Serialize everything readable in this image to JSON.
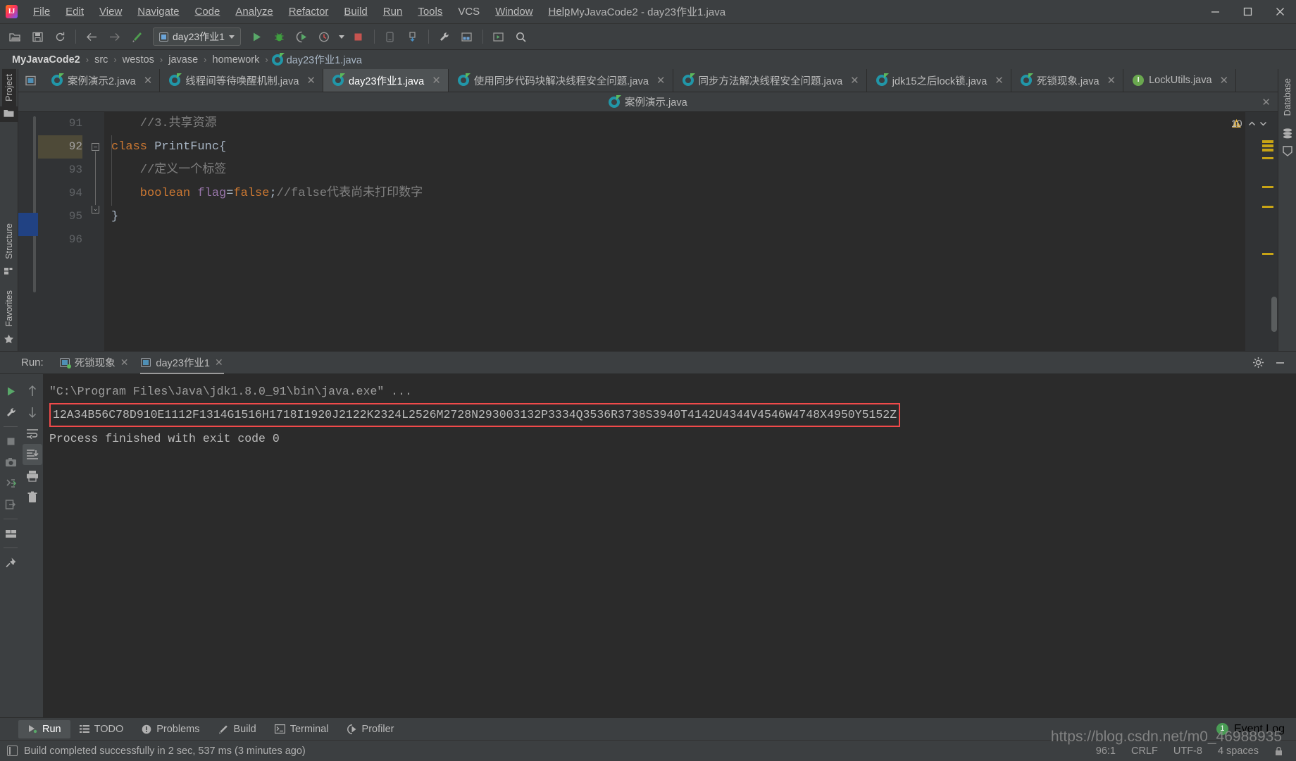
{
  "window": {
    "title": "MyJavaCode2 - day23作业1.java",
    "minimize": "–",
    "maximize": "❐",
    "close": "✕"
  },
  "menu": [
    {
      "label": "File"
    },
    {
      "label": "Edit"
    },
    {
      "label": "View"
    },
    {
      "label": "Navigate"
    },
    {
      "label": "Code"
    },
    {
      "label": "Analyze"
    },
    {
      "label": "Refactor"
    },
    {
      "label": "Build"
    },
    {
      "label": "Run"
    },
    {
      "label": "Tools"
    },
    {
      "label": "VCS"
    },
    {
      "label": "Window"
    },
    {
      "label": "Help"
    }
  ],
  "toolbar": {
    "icons": [
      "open-folder-icon",
      "save-all-icon",
      "sync-icon",
      "back-arrow-icon",
      "forward-arrow-icon",
      "build-hammer-icon"
    ],
    "run_config": "day23作业1",
    "run_icon": "run-green-triangle-icon",
    "debug_icon": "debug-bug-icon",
    "coverage_icon": "run-with-coverage-icon",
    "profiler_icon": "profile-clock-icon",
    "stop_icon": "stop-red-square-icon",
    "extra_icons": [
      "update-app-icon",
      "install-apk-icon",
      "settings-wrench-icon",
      "project-structure-icon",
      "avd-manager-icon",
      "search-everywhere-icon"
    ]
  },
  "breadcrumb": {
    "items": [
      "MyJavaCode2",
      "src",
      "westos",
      "javase",
      "homework"
    ],
    "file": "day23作业1.java",
    "separator": "›"
  },
  "left_rail": {
    "top": {
      "label": "Project",
      "icon": "project-folder-icon"
    },
    "bottom": [
      {
        "label": "Structure",
        "icon": "structure-icon"
      },
      {
        "label": "Favorites",
        "icon": "favorites-star-icon"
      }
    ]
  },
  "right_rail": [
    {
      "label": "Database",
      "icon": "database-icon"
    },
    {
      "label": "",
      "icon": "ant-build-icon"
    }
  ],
  "editor_tabs_row1": [
    {
      "label": "案例演示2.java",
      "icon": "java-class-icon",
      "active": false
    },
    {
      "label": "线程间等待唤醒机制.java",
      "icon": "java-class-icon",
      "active": false
    },
    {
      "label": "day23作业1.java",
      "icon": "java-class-icon",
      "active": true
    },
    {
      "label": "使用同步代码块解决线程安全问题.java",
      "icon": "java-class-icon",
      "active": false
    },
    {
      "label": "同步方法解决线程安全问题.java",
      "icon": "java-class-icon",
      "active": false
    },
    {
      "label": "jdk15之后lock锁.java",
      "icon": "java-class-icon",
      "active": false
    },
    {
      "label": "死锁现象.java",
      "icon": "java-class-icon",
      "active": false
    },
    {
      "label": "LockUtils.java",
      "icon": "java-interface-icon",
      "active": false
    }
  ],
  "editor_tabs_row2": [
    {
      "label": "案例演示.java",
      "icon": "java-class-icon",
      "active": false
    }
  ],
  "editor": {
    "close_tab_glyph": "✕",
    "warning_count": "10",
    "warning_icon": "warning-triangle-icon",
    "prev_icon": "chevron-up-icon",
    "next_icon": "chevron-down-icon",
    "lines": [
      {
        "num": "91",
        "segments": [
          {
            "t": "    //3.共享资源",
            "c": "cmt"
          }
        ],
        "highlight": false
      },
      {
        "num": "92",
        "segments": [
          {
            "t": "class ",
            "c": "k"
          },
          {
            "t": "PrintFunc{",
            "c": "plain"
          }
        ],
        "highlight": true
      },
      {
        "num": "93",
        "segments": [
          {
            "t": "    //定义一个标签",
            "c": "cmt"
          }
        ],
        "highlight": false
      },
      {
        "num": "94",
        "segments": [
          {
            "t": "    boolean ",
            "c": "k"
          },
          {
            "t": "flag",
            "c": "fld"
          },
          {
            "t": "=",
            "c": "plain"
          },
          {
            "t": "false",
            "c": "k"
          },
          {
            "t": ";",
            "c": "plain"
          },
          {
            "t": "//false代表尚未打印数字",
            "c": "cmt"
          }
        ],
        "highlight": false
      },
      {
        "num": "95",
        "segments": [
          {
            "t": "}",
            "c": "plain"
          }
        ],
        "highlight": false
      },
      {
        "num": "96",
        "segments": [
          {
            "t": "",
            "c": "plain"
          }
        ],
        "highlight": false
      }
    ]
  },
  "run_panel": {
    "label": "Run:",
    "tabs": [
      {
        "label": "死锁现象",
        "active": false
      },
      {
        "label": "day23作业1",
        "active": true
      }
    ],
    "close_glyph": "✕",
    "settings_icon": "gear-icon",
    "minimize_icon": "minimize-icon",
    "side_buttons_col1": [
      "rerun-green-triangle-icon",
      "settings-wrench-icon",
      "stop-square-icon",
      "screenshot-camera-icon",
      "dump-threads-icon",
      "export-icon",
      "layout-icon",
      "pin-tab-icon"
    ],
    "side_buttons_col2": [
      "up-arrow-icon",
      "down-arrow-icon",
      "soft-wrap-icon",
      "scroll-to-end-icon",
      "print-icon",
      "clear-all-trash-icon"
    ],
    "console": {
      "command_line": "\"C:\\Program Files\\Java\\jdk1.8.0_91\\bin\\java.exe\" ...",
      "highlighted_output": "12A34B56C78D910E1112F1314G1516H1718I1920J2122K2324L2526M2728N293003132P3334Q3536R3738S3940T4142U4344V4546W4748X4950Y5152Z",
      "highlight_color": "#f04a4a",
      "exit_line": "Process finished with exit code 0"
    }
  },
  "tool_windows": [
    {
      "label": "Run",
      "icon": "run-triangle-icon",
      "active": true
    },
    {
      "label": "TODO",
      "icon": "todo-list-icon",
      "active": false
    },
    {
      "label": "Problems",
      "icon": "problems-icon",
      "active": false
    },
    {
      "label": "Build",
      "icon": "build-hammer-icon",
      "active": false
    },
    {
      "label": "Terminal",
      "icon": "terminal-icon",
      "active": false
    },
    {
      "label": "Profiler",
      "icon": "profiler-icon",
      "active": false
    }
  ],
  "event_log": {
    "count": "1",
    "label": "Event Log"
  },
  "status_bar": {
    "message": "Build completed successfully in 2 sec, 537 ms (3 minutes ago)",
    "caret": "96:1",
    "line_sep": "CRLF",
    "encoding": "UTF-8",
    "indent": "4 spaces",
    "lock_icon": "lock-icon"
  },
  "watermark": "https://blog.csdn.net/m0_46988935"
}
